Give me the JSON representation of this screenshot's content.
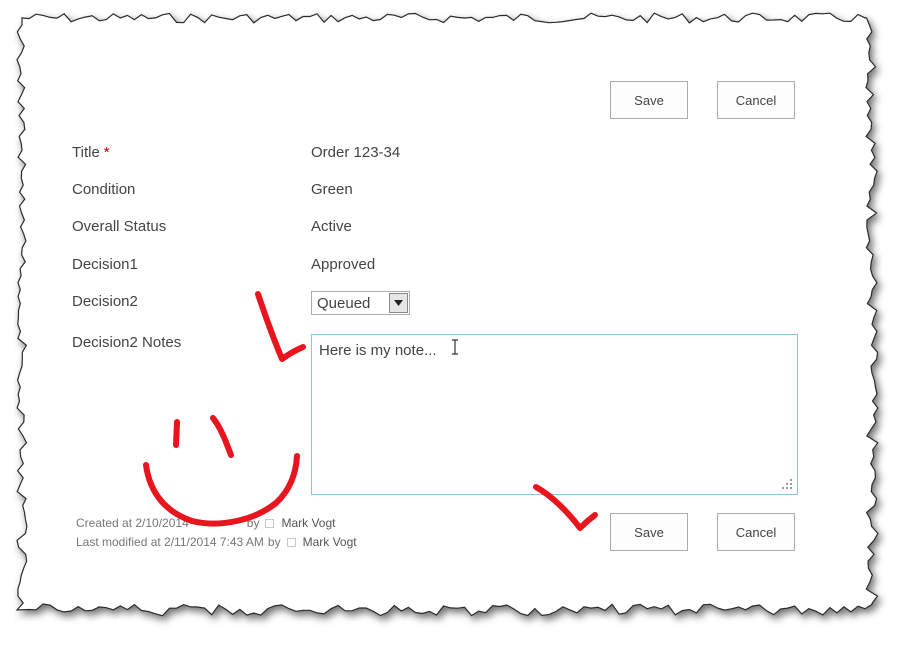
{
  "toolbar_top": {
    "save_label": "Save",
    "cancel_label": "Cancel"
  },
  "fields": {
    "title": {
      "label": "Title",
      "required_mark": "*",
      "value": "Order 123-34"
    },
    "condition": {
      "label": "Condition",
      "value": "Green"
    },
    "overall_status": {
      "label": "Overall Status",
      "value": "Active"
    },
    "decision1": {
      "label": "Decision1",
      "value": "Approved"
    },
    "decision2": {
      "label": "Decision2",
      "selected": "Queued"
    },
    "decision2_notes": {
      "label": "Decision2 Notes",
      "value": "Here is my note..."
    }
  },
  "footer": {
    "created_prefix": "Created at 2/10/2014",
    "created_obscured": "",
    "created_by": "by",
    "created_author": "Mark Vogt",
    "modified_prefix": "Last modified at 2/11/2014 7:43 AM",
    "modified_by": "by",
    "modified_author": "Mark Vogt"
  },
  "toolbar_bottom": {
    "save_label": "Save",
    "cancel_label": "Cancel"
  },
  "colors": {
    "annotation_red": "#e8141e",
    "required_red": "#bf0000",
    "textarea_border": "#92c0e0"
  },
  "icons": [
    "dropdown-arrow-icon",
    "text-cursor-icon",
    "resize-grip-icon",
    "presence-icon"
  ]
}
